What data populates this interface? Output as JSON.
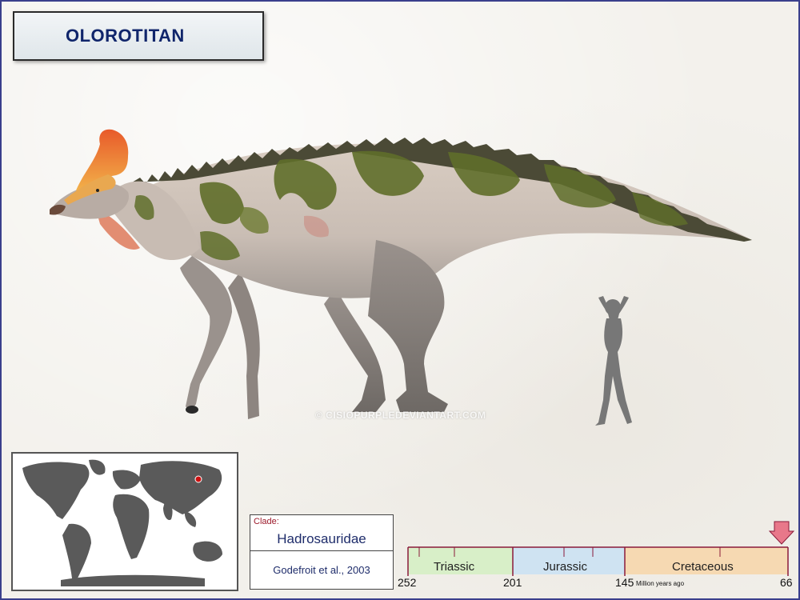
{
  "title": "OLOROTITAN",
  "watermark": "© CISIOPURPLEDEVIANTART.COM",
  "map": {
    "marker_color": "#cc1111",
    "land_color": "#5a5a5a"
  },
  "clade": {
    "label": "Clade:",
    "name": "Hadrosauridae",
    "author": "Godefroit et al., 2003"
  },
  "timeline": {
    "periods": [
      {
        "name": "Triassic",
        "start": 252,
        "end": 201,
        "color": "#d8efc8"
      },
      {
        "name": "Jurassic",
        "start": 201,
        "end": 145,
        "color": "#cfe3f2"
      },
      {
        "name": "Cretaceous",
        "start": 145,
        "end": 66,
        "color": "#f6d9b2"
      }
    ],
    "ticks": [
      "252",
      "201",
      "145",
      "66"
    ],
    "unit_label": "Million years ago",
    "marker_color": "#e8788a",
    "axis_color": "#8a1a3a"
  },
  "colors": {
    "frame": "#3a3f8c",
    "title_text": "#10256b",
    "silhouette": "#777777"
  }
}
